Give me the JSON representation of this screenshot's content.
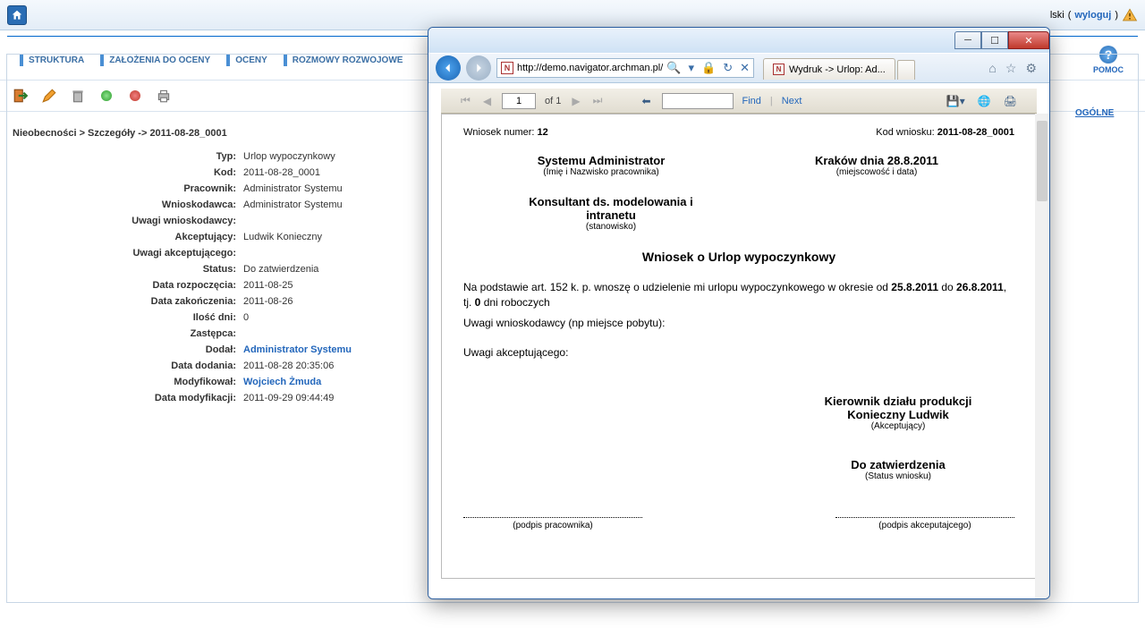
{
  "topbar": {
    "lang_suffix": "lski",
    "logout": "wyloguj"
  },
  "nav": {
    "items": [
      "STRUKTURA",
      "ZAŁOŻENIA DO OCENY",
      "OCENY",
      "ROZMOWY ROZWOJOWE"
    ],
    "help": "POMOC"
  },
  "right": {
    "general": "OGÓLNE"
  },
  "breadcrumb": "Nieobecności > Szczegóły -> 2011-08-28_0001",
  "details": {
    "typ_lbl": "Typ:",
    "typ": "Urlop wypoczynkowy",
    "kod_lbl": "Kod:",
    "kod": "2011-08-28_0001",
    "prac_lbl": "Pracownik:",
    "prac": "Administrator Systemu",
    "wniosk_lbl": "Wnioskodawca:",
    "wniosk": "Administrator Systemu",
    "uwagi_w_lbl": "Uwagi wnioskodawcy:",
    "uwagi_w": "",
    "akc_lbl": "Akceptujący:",
    "akc": "Ludwik Konieczny",
    "uwagi_a_lbl": "Uwagi akceptującego:",
    "uwagi_a": "",
    "status_lbl": "Status:",
    "status": "Do zatwierdzenia",
    "data_roz_lbl": "Data rozpoczęcia:",
    "data_roz": "2011-08-25",
    "data_zak_lbl": "Data zakończenia:",
    "data_zak": "2011-08-26",
    "ilosc_lbl": "Ilość dni:",
    "ilosc": "0",
    "zast_lbl": "Zastępca:",
    "zast": "",
    "dodal_lbl": "Dodał:",
    "dodal": "Administrator Systemu",
    "data_dod_lbl": "Data dodania:",
    "data_dod": "2011-08-28 20:35:06",
    "mod_lbl": "Modyfikował:",
    "mod": "Wojciech Żmuda",
    "data_mod_lbl": "Data modyfikacji:",
    "data_mod": "2011-09-29 09:44:49"
  },
  "popup": {
    "url": "http://demo.navigator.archman.pl/DW",
    "search_icon": "🔍",
    "tab_title": "Wydruk -> Urlop: Ad...",
    "report_toolbar": {
      "page": "1",
      "of": "of 1",
      "find": "Find",
      "next": "Next"
    },
    "report": {
      "num_lbl": "Wniosek numer:",
      "num": "12",
      "kod_lbl": "Kod wniosku:",
      "kod": "2011-08-28_0001",
      "employee": "Systemu Administrator",
      "employee_sub": "(Imię i Nazwisko pracownika)",
      "city": "Kraków dnia 28.8.2011",
      "city_sub": "(miejscowość i data)",
      "position": "Konsultant ds. modelowania i intranetu",
      "position_sub": "(stanowisko)",
      "title": "Wniosek o Urlop wypoczynkowy",
      "body_pre": "Na podstawie art. 152 k. p. wnoszę o udzielenie mi urlopu wypoczynkowego w okresie od ",
      "date_from": "25.8.2011",
      "body_mid": " do ",
      "date_to": "26.8.2011",
      "body_after": ", tj. ",
      "days": "0",
      "body_end": " dni roboczych",
      "remarks_w": "Uwagi wnioskodawcy (np miejsce pobytu):",
      "remarks_a": "Uwagi akceptującego:",
      "approver_title": "Kierownik działu produkcji",
      "approver_name": "Konieczny Ludwik",
      "approver_sub": "(Akceptujący)",
      "status": "Do zatwierdzenia",
      "status_sub": "(Status wniosku)",
      "sig_emp": "(podpis pracownika)",
      "sig_acc": "(podpis akceputajcego)"
    }
  }
}
